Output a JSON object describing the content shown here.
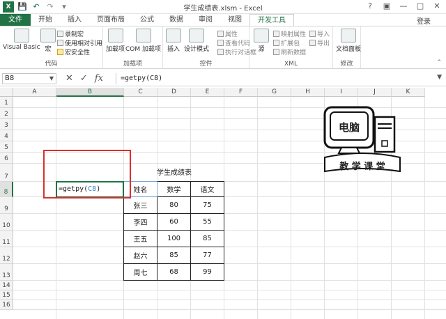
{
  "window": {
    "title": "学生成绩表.xlsm - Excel"
  },
  "tabs": [
    "文件",
    "开始",
    "插入",
    "页面布局",
    "公式",
    "数据",
    "审阅",
    "视图",
    "开发工具"
  ],
  "active_tab": "开发工具",
  "login": "登录",
  "ribbon": {
    "code": {
      "label": "代码",
      "vb": "Visual Basic",
      "macro": "宏",
      "record": "录制宏",
      "relative": "使用相对引用",
      "security": "宏安全性"
    },
    "addins": {
      "label": "加载项",
      "addin": "加载项",
      "com": "COM 加载项"
    },
    "controls": {
      "label": "控件",
      "insert": "插入",
      "design": "设计模式",
      "props": "属性",
      "view_code": "查看代码",
      "run_dialog": "执行对话框"
    },
    "xml": {
      "label": "XML",
      "source": "源",
      "map_props": "映射属性",
      "expand": "扩展包",
      "refresh": "刷新数据",
      "import": "导入",
      "export": "导出"
    },
    "modify": {
      "label": "修改",
      "doc_panel": "文档面板"
    }
  },
  "formula_bar": {
    "name_box": "B8",
    "formula": "=getpy(C8)"
  },
  "columns": [
    "A",
    "B",
    "C",
    "D",
    "E",
    "F",
    "G",
    "H",
    "I",
    "J",
    "K"
  ],
  "rows": [
    "1",
    "2",
    "3",
    "4",
    "5",
    "6",
    "7",
    "8",
    "9",
    "10",
    "11",
    "12",
    "13",
    "14",
    "15",
    "16"
  ],
  "active_cell": {
    "prefix": "=getpy(",
    "ref": "C8",
    "suffix": ")"
  },
  "table": {
    "title": "学生成绩表",
    "headers": [
      "姓名",
      "数学",
      "语文"
    ],
    "rows": [
      [
        "张三",
        "80",
        "75"
      ],
      [
        "李四",
        "60",
        "55"
      ],
      [
        "王五",
        "100",
        "85"
      ],
      [
        "赵六",
        "85",
        "77"
      ],
      [
        "周七",
        "68",
        "99"
      ]
    ]
  },
  "logo": {
    "line1": "电脑",
    "line2": "教 学 课 堂"
  },
  "colors": {
    "accent": "#217346",
    "highlight_box": "#d9302c",
    "ref": "#3b82c4"
  }
}
